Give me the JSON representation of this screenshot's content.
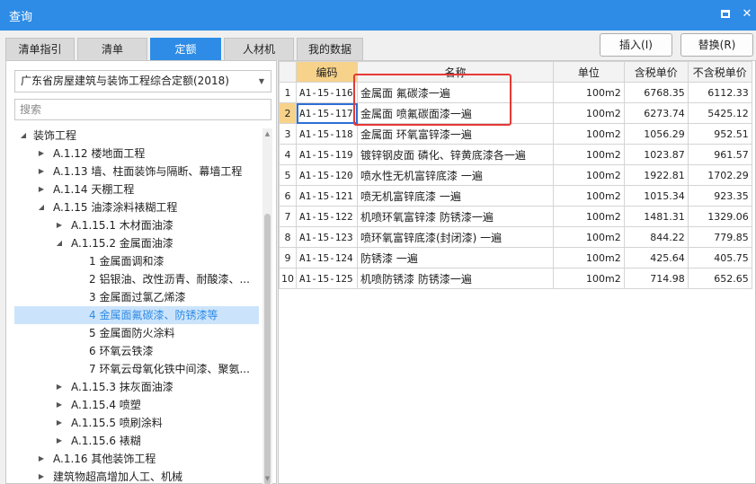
{
  "window": {
    "title": "查询"
  },
  "tabs": [
    {
      "label": "清单指引",
      "active": false
    },
    {
      "label": "清单",
      "active": false
    },
    {
      "label": "定额",
      "active": true
    },
    {
      "label": "人材机",
      "active": false
    },
    {
      "label": "我的数据",
      "active": false
    }
  ],
  "toolbar": {
    "insert_label": "插入(I)",
    "replace_label": "替换(R)"
  },
  "library": {
    "selected": "广东省房屋建筑与装饰工程综合定额(2018)"
  },
  "search": {
    "placeholder": "搜索",
    "value": ""
  },
  "tree": [
    {
      "label": "装饰工程",
      "expanded": true
    },
    {
      "label": "A.1.12 楼地面工程",
      "expanded": false
    },
    {
      "label": "A.1.13 墙、柱面装饰与隔断、幕墙工程",
      "expanded": false
    },
    {
      "label": "A.1.14 天棚工程",
      "expanded": false
    },
    {
      "label": "A.1.15 油漆涂料裱糊工程",
      "expanded": true
    },
    {
      "label": "A.1.15.1 木材面油漆",
      "expanded": false
    },
    {
      "label": "A.1.15.2 金属面油漆",
      "expanded": true
    },
    {
      "label": "1 金属面调和漆"
    },
    {
      "label": "2 铝银油、改性沥青、耐酸漆、..."
    },
    {
      "label": "3 金属面过氯乙烯漆"
    },
    {
      "label": "4 金属面氟碳漆、防锈漆等",
      "selected": true
    },
    {
      "label": "5 金属面防火涂料"
    },
    {
      "label": "6 环氧云铁漆"
    },
    {
      "label": "7 环氧云母氧化铁中间漆、聚氨..."
    },
    {
      "label": "A.1.15.3 抹灰面油漆",
      "expanded": false
    },
    {
      "label": "A.1.15.4 喷塑",
      "expanded": false
    },
    {
      "label": "A.1.15.5 喷刷涂料",
      "expanded": false
    },
    {
      "label": "A.1.15.6 裱糊",
      "expanded": false
    },
    {
      "label": "A.1.16 其他装饰工程",
      "expanded": false
    },
    {
      "label": "建筑物超高增加人工、机械",
      "expanded": false
    }
  ],
  "table": {
    "headers": {
      "code": "编码",
      "name": "名称",
      "unit": "单位",
      "tax_price": "含税单价",
      "notax_price": "不含税单价"
    },
    "selected_row": 2,
    "rows": [
      {
        "num": "1",
        "code": "A1-15-116",
        "name": "金属面 氟碳漆一遍",
        "unit": "100m2",
        "tax_price": "6768.35",
        "notax_price": "6112.33"
      },
      {
        "num": "2",
        "code": "A1-15-117",
        "name": "金属面 喷氟碳面漆一遍",
        "unit": "100m2",
        "tax_price": "6273.74",
        "notax_price": "5425.12"
      },
      {
        "num": "3",
        "code": "A1-15-118",
        "name": "金属面 环氧富锌漆一遍",
        "unit": "100m2",
        "tax_price": "1056.29",
        "notax_price": "952.51"
      },
      {
        "num": "4",
        "code": "A1-15-119",
        "name": "镀锌钢皮面 磷化、锌黄底漆各一遍",
        "unit": "100m2",
        "tax_price": "1023.87",
        "notax_price": "961.57"
      },
      {
        "num": "5",
        "code": "A1-15-120",
        "name": "喷水性无机富锌底漆 一遍",
        "unit": "100m2",
        "tax_price": "1922.81",
        "notax_price": "1702.29"
      },
      {
        "num": "6",
        "code": "A1-15-121",
        "name": "喷无机富锌底漆 一遍",
        "unit": "100m2",
        "tax_price": "1015.34",
        "notax_price": "923.35"
      },
      {
        "num": "7",
        "code": "A1-15-122",
        "name": "机喷环氧富锌漆 防锈漆一遍",
        "unit": "100m2",
        "tax_price": "1481.31",
        "notax_price": "1329.06"
      },
      {
        "num": "8",
        "code": "A1-15-123",
        "name": "喷环氧富锌底漆(封闭漆) 一遍",
        "unit": "100m2",
        "tax_price": "844.22",
        "notax_price": "779.85"
      },
      {
        "num": "9",
        "code": "A1-15-124",
        "name": "防锈漆 一遍",
        "unit": "100m2",
        "tax_price": "425.64",
        "notax_price": "405.75"
      },
      {
        "num": "10",
        "code": "A1-15-125",
        "name": "机喷防锈漆 防锈漆一遍",
        "unit": "100m2",
        "tax_price": "714.98",
        "notax_price": "652.65"
      }
    ]
  },
  "colors": {
    "accent": "#2e8ce6",
    "header_highlight": "#f7d28a",
    "annotation": "#e53935",
    "selection": "#cce4fb"
  }
}
